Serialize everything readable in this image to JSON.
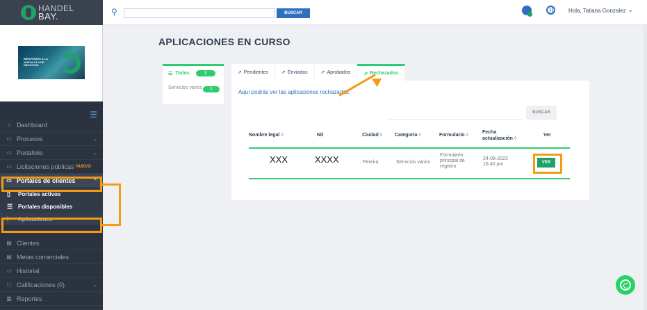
{
  "brand": {
    "line1": "HANDEL",
    "line2": "BAY."
  },
  "banner": {
    "text": "BIENVENIDO A LA NUEVA OLA DE NEGOCIOS"
  },
  "topbar": {
    "search_placeholder": "",
    "search_button": "BUSCAR",
    "user_greeting": "Hola, Tatiana Gonzalez"
  },
  "sidebar": {
    "items_top": [
      {
        "label": "Dashboard",
        "icon": "home-icon"
      },
      {
        "label": "Procesos",
        "icon": "briefcase-icon",
        "chevron": true
      },
      {
        "label": "Portafolio",
        "icon": "briefcase-icon",
        "chevron": true
      },
      {
        "label": "Licitaciones públicas",
        "icon": "briefcase-icon",
        "badge": "NUEVO"
      },
      {
        "label": "Portales de clientes",
        "icon": "briefcase-icon",
        "chevron": true,
        "active": true
      }
    ],
    "sub_items": [
      {
        "label": "Portales activos",
        "icon": "document-icon"
      },
      {
        "label": "Portales disponibles",
        "icon": "list-icon"
      },
      {
        "label": "Aplicaciones",
        "icon": "tree-icon",
        "current": true
      }
    ],
    "items_bottom": [
      {
        "label": "Clientes",
        "icon": "clipboard-icon"
      },
      {
        "label": "Metas comerciales",
        "icon": "clipboard-icon"
      },
      {
        "label": "Historial",
        "icon": "folder-icon"
      },
      {
        "label": "Calificaciones (0)",
        "icon": "square-icon",
        "chevron": true
      },
      {
        "label": "Reportes",
        "icon": "chart-icon"
      }
    ]
  },
  "main": {
    "title": "APLICACIONES EN CURSO",
    "left_panel": {
      "head_label": "Todos",
      "head_count": "1",
      "rows": [
        {
          "label": "Servicios varios",
          "count": "1"
        }
      ]
    },
    "tabs": [
      {
        "label": "Pendientes",
        "active": false
      },
      {
        "label": "Enviadas",
        "active": false
      },
      {
        "label": "Aprobados",
        "active": false
      },
      {
        "label": "Rechazados",
        "active": true
      }
    ],
    "info_text": "Aquí podrás ver las aplicaciones rechazadas.",
    "filter_button": "BUSCAR",
    "table": {
      "headers": [
        "Nombre legal",
        "Nit",
        "Ciudad",
        "Categoría",
        "Formulario",
        "Fecha actualización",
        "Ver"
      ],
      "row": {
        "nombre": "XXX",
        "nit": "XXXX",
        "ciudad": "Pereira",
        "categoria": "Servicios varios",
        "formulario": "Formulario principal de registro",
        "fecha": "24-08-2023 16:40 pm",
        "ver": "VER"
      }
    }
  },
  "colors": {
    "accent_green": "#2ecc71",
    "brand_blue": "#2f6fbf",
    "highlight_orange": "#f39c12",
    "sidebar_bg": "#2c3340"
  }
}
